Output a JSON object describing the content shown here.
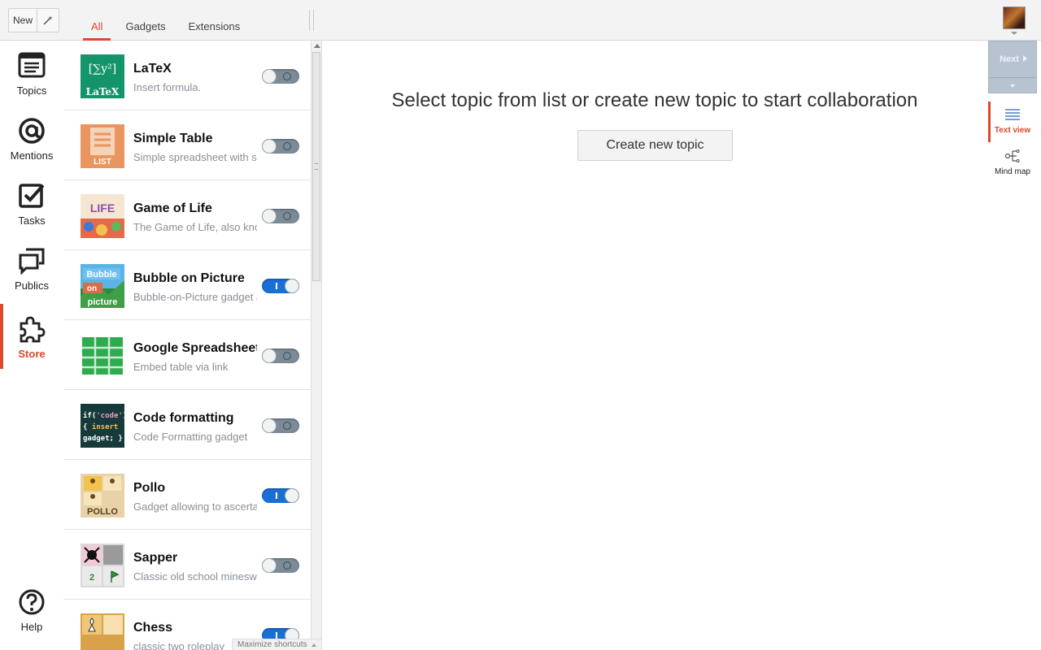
{
  "toolbar": {
    "new_label": "New",
    "wand_icon": "magic-wand-icon"
  },
  "tabs": [
    {
      "label": "All",
      "active": true
    },
    {
      "label": "Gadgets",
      "active": false
    },
    {
      "label": "Extensions",
      "active": false
    }
  ],
  "nav": [
    {
      "label": "Topics",
      "icon": "topics-icon",
      "active": false
    },
    {
      "label": "Mentions",
      "icon": "at-sign-icon",
      "active": false
    },
    {
      "label": "Tasks",
      "icon": "checkbox-icon",
      "active": false
    },
    {
      "label": "Publics",
      "icon": "chat-bubbles-icon",
      "active": false
    },
    {
      "label": "Store",
      "icon": "puzzle-piece-icon",
      "active": true
    },
    {
      "label": "Help",
      "icon": "help-icon",
      "active": false
    }
  ],
  "store_items": [
    {
      "name": "LaTeX",
      "desc": "Insert formula.",
      "enabled": false,
      "thumb_text": "LaTeX"
    },
    {
      "name": "Simple Table",
      "desc": "Simple spreadsheet with s",
      "enabled": false,
      "thumb_text": "LIST"
    },
    {
      "name": "Game of Life",
      "desc": "The Game of Life, also kno",
      "enabled": false,
      "thumb_text": "LIFE"
    },
    {
      "name": "Bubble on Picture",
      "desc": "Bubble-on-Picture gadget a",
      "enabled": true,
      "thumb_text": "Bubble on picture"
    },
    {
      "name": "Google Spreadsheet",
      "desc": "Embed table via link",
      "enabled": false,
      "thumb_text": ""
    },
    {
      "name": "Code formatting",
      "desc": "Code Formatting gadget",
      "enabled": false,
      "thumb_text": "if('code') { insert gadget; }"
    },
    {
      "name": "Pollo",
      "desc": "Gadget allowing to ascerta",
      "enabled": true,
      "thumb_text": "POLLO"
    },
    {
      "name": "Sapper",
      "desc": "Classic old school minesw",
      "enabled": false,
      "thumb_text": "2"
    },
    {
      "name": "Chess",
      "desc": "classic two roleplay",
      "enabled": true,
      "thumb_text": ""
    }
  ],
  "maximize_label": "Maximize shortcuts",
  "main": {
    "prompt": "Select topic from list or create new topic to start collaboration",
    "create_label": "Create new topic"
  },
  "right": {
    "next_label": "Next",
    "views": [
      {
        "label": "Text view",
        "active": true,
        "icon": "text-view-icon"
      },
      {
        "label": "Mind map",
        "active": false,
        "icon": "mind-map-icon"
      }
    ]
  },
  "colors": {
    "accent": "#d9492b",
    "toggle_on": "#1a6fd6",
    "toggle_off": "#7d8b98"
  }
}
